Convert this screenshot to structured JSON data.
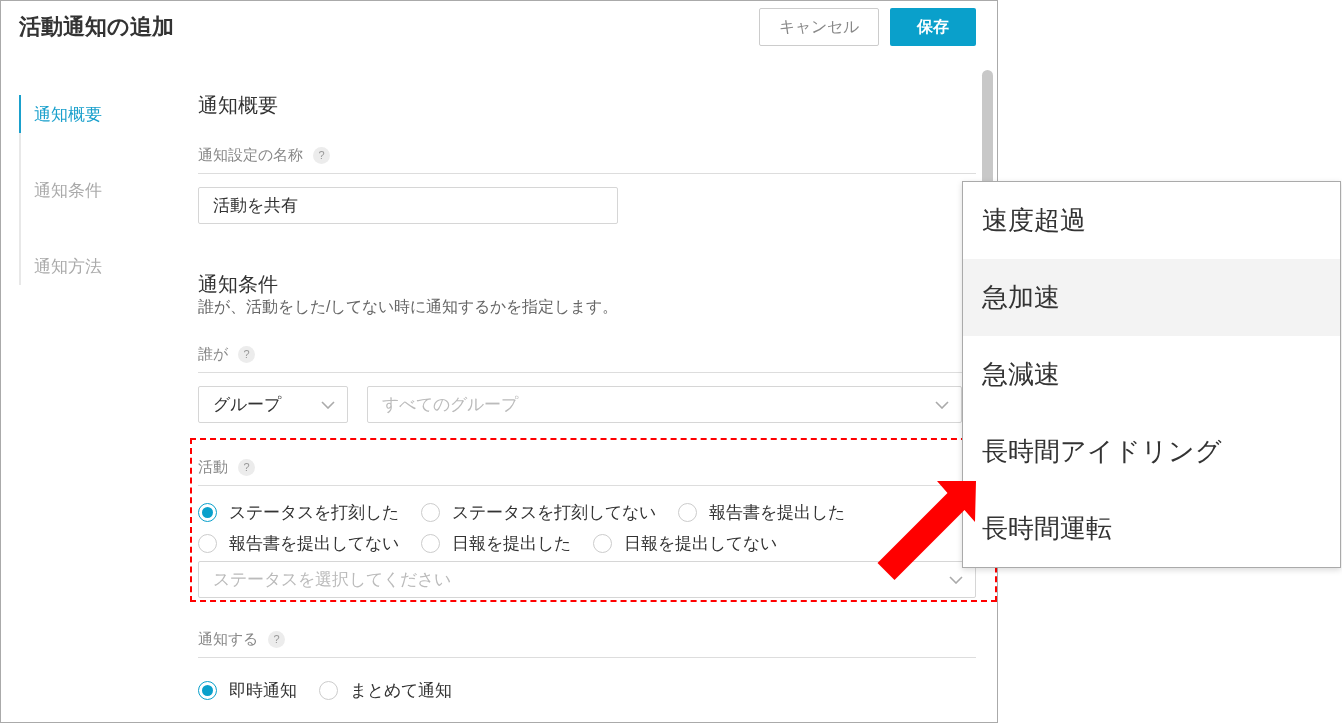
{
  "dialog": {
    "title": "活動通知の追加",
    "buttons": [
      {
        "label": "キャンセル",
        "kind": "secondary"
      },
      {
        "label": "保存",
        "kind": "primary"
      }
    ]
  },
  "sidebar": {
    "items": [
      {
        "label": "通知概要",
        "selected": true
      },
      {
        "label": "通知条件",
        "selected": false
      },
      {
        "label": "通知方法",
        "selected": false
      }
    ]
  },
  "sections": [
    {
      "heading": "通知概要",
      "fields": [
        {
          "label": "通知設定の名称",
          "help": "?",
          "highlighted": false,
          "controls": [
            {
              "kind": "input",
              "value": "活動を共有"
            }
          ]
        }
      ]
    },
    {
      "heading": "通知条件",
      "description": "誰が、活動をした/してない時に通知するかを指定します。",
      "fields": [
        {
          "label": "誰が",
          "help": "?",
          "highlighted": false,
          "controls": [
            {
              "kind": "select",
              "value": "グループ"
            },
            {
              "kind": "select",
              "placeholder": "すべてのグループ"
            }
          ]
        },
        {
          "label": "活動",
          "help": "?",
          "highlighted": true,
          "controls": [
            {
              "kind": "radios",
              "options": [
                {
                  "label": "ステータスを打刻した",
                  "checked": true
                },
                {
                  "label": "ステータスを打刻してない",
                  "checked": false
                },
                {
                  "label": "報告書を提出した",
                  "checked": false
                },
                {
                  "label": "報告書を提出してない",
                  "checked": false
                },
                {
                  "label": "日報を提出した",
                  "checked": false
                },
                {
                  "label": "日報を提出してない",
                  "checked": false
                }
              ]
            },
            {
              "kind": "select",
              "placeholder": "ステータスを選択してください"
            }
          ]
        },
        {
          "label": "通知する",
          "help": "?",
          "highlighted": false,
          "controls": [
            {
              "kind": "radios",
              "options": [
                {
                  "label": "即時通知",
                  "checked": true
                },
                {
                  "label": "まとめて通知",
                  "checked": false
                }
              ]
            }
          ]
        }
      ]
    }
  ],
  "dropdown": {
    "items": [
      {
        "label": "速度超過",
        "selected": false
      },
      {
        "label": "急加速",
        "selected": true
      },
      {
        "label": "急減速",
        "selected": false
      },
      {
        "label": "長時間アイドリング",
        "selected": false
      },
      {
        "label": "長時間運転",
        "selected": false
      }
    ]
  }
}
